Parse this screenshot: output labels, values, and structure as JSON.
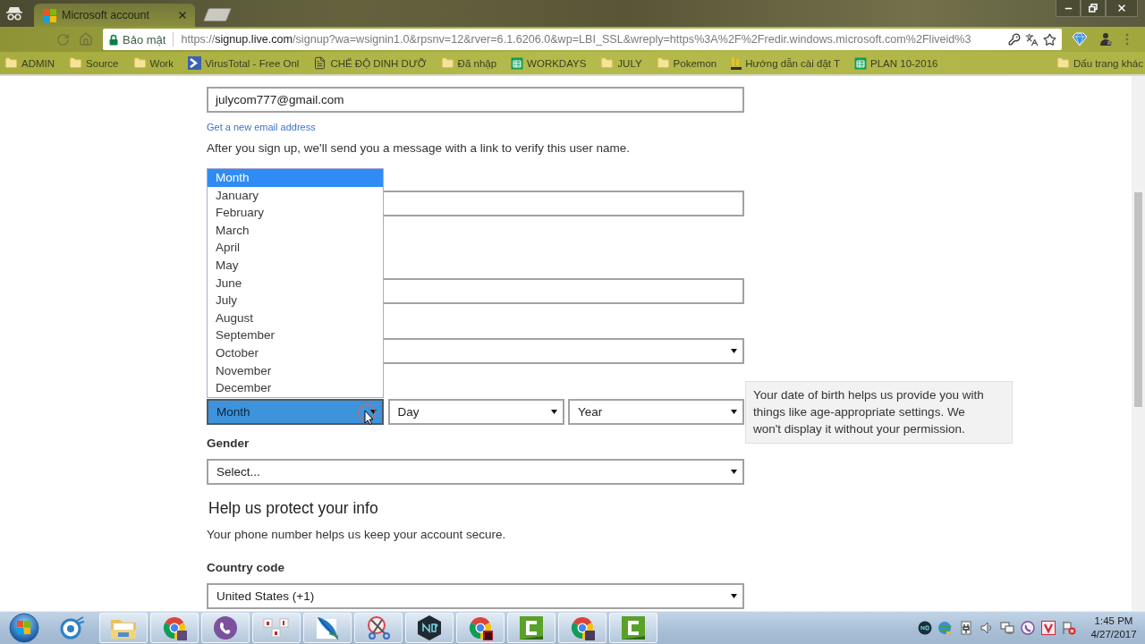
{
  "browser": {
    "tabs": [
      {
        "title": "Microsoft account",
        "selected": true
      }
    ],
    "security_label": "Bảo mật",
    "url": {
      "scheme": "https://",
      "host": "signup.live.com",
      "path": "/signup?wa=wsignin1.0&rpsnv=12&rver=6.1.6206.0&wp=LBI_SSL&wreply=https%3A%2F%2Fredir.windows.microsoft.com%2Fliveid%3"
    },
    "bookmarks": [
      {
        "label": "ADMIN",
        "kind": "folder"
      },
      {
        "label": "Source",
        "kind": "folder"
      },
      {
        "label": "Work",
        "kind": "folder"
      },
      {
        "label": "VirusTotal - Free Onl",
        "kind": "site"
      },
      {
        "label": "CHẾ ĐỘ DINH DƯỠ",
        "kind": "page"
      },
      {
        "label": "Đã nhập",
        "kind": "folder"
      },
      {
        "label": "WORKDAYS",
        "kind": "sheet"
      },
      {
        "label": "JULY",
        "kind": "folder"
      },
      {
        "label": "Pokemon",
        "kind": "folder"
      },
      {
        "label": "Hướng dẫn cài đặt T",
        "kind": "guide"
      },
      {
        "label": "PLAN 10-2016",
        "kind": "sheet"
      }
    ],
    "other_bookmarks": {
      "label": "Dấu trang khác",
      "kind": "folder"
    }
  },
  "form": {
    "username": {
      "value": "julycom777@gmail.com"
    },
    "new_email_link": "Get a new email address",
    "verify_note": "After you sign up, we'll send you a message with a link to verify this user name.",
    "covered_fields": [
      {
        "kind": "input"
      },
      {
        "kind": "input"
      },
      {
        "kind": "select"
      }
    ],
    "birth_date": {
      "selects": [
        {
          "value": "Month",
          "focused": true
        },
        {
          "value": "Day",
          "focused": false
        },
        {
          "value": "Year",
          "focused": false
        }
      ],
      "month_options": [
        {
          "label": "Month",
          "selected": true
        },
        {
          "label": "January",
          "selected": false
        },
        {
          "label": "February",
          "selected": false
        },
        {
          "label": "March",
          "selected": false
        },
        {
          "label": "April",
          "selected": false
        },
        {
          "label": "May",
          "selected": false
        },
        {
          "label": "June",
          "selected": false
        },
        {
          "label": "July",
          "selected": false
        },
        {
          "label": "August",
          "selected": false
        },
        {
          "label": "September",
          "selected": false
        },
        {
          "label": "October",
          "selected": false
        },
        {
          "label": "November",
          "selected": false
        },
        {
          "label": "December",
          "selected": false
        }
      ],
      "tooltip": "Your date of birth helps us provide you with things like age-appropriate settings. We won't display it without your permission."
    },
    "gender": {
      "label": "Gender",
      "value": "Select..."
    },
    "protect_heading": "Help us protect your info",
    "phone_note": "Your phone number helps us keep your account secure.",
    "country": {
      "label": "Country code",
      "value": "United States (+1)"
    }
  },
  "taskbar": {
    "apps": [
      {
        "kind": "round_logo",
        "running": false
      },
      {
        "kind": "explorer",
        "running": true
      },
      {
        "kind": "chrome",
        "running": true
      },
      {
        "kind": "viber",
        "running": true
      },
      {
        "kind": "tiles",
        "running": true
      },
      {
        "kind": "feather",
        "running": true
      },
      {
        "kind": "scissors",
        "running": true
      },
      {
        "kind": "nox",
        "running": true
      },
      {
        "kind": "chrome_badge",
        "running": true
      },
      {
        "kind": "camtasia",
        "running": true
      },
      {
        "kind": "chrome_profile",
        "running": true
      },
      {
        "kind": "camtasia",
        "running": true
      }
    ],
    "tray": [
      {
        "kind": "nox"
      },
      {
        "kind": "globe"
      },
      {
        "kind": "plug"
      },
      {
        "kind": "speaker"
      },
      {
        "kind": "network"
      },
      {
        "kind": "viber"
      },
      {
        "kind": "v_tile"
      },
      {
        "kind": "flag_error"
      }
    ],
    "clock": {
      "time": "1:45 PM",
      "date": "4/27/2017"
    }
  }
}
